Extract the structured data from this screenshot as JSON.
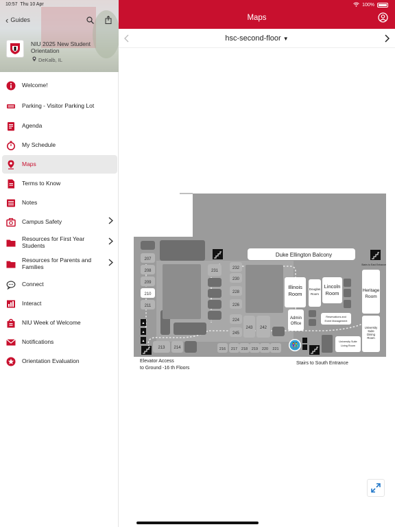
{
  "status": {
    "time": "10:57",
    "date": "Thu 10 Apr",
    "battery": "100%"
  },
  "sidebar": {
    "back_label": "Guides",
    "guide_title": "NIU 2025 New Student Orientation",
    "location": "DeKalb, IL",
    "items": [
      {
        "label": "Welcome!",
        "icon": "info-icon",
        "active": false
      },
      {
        "label": "Parking - Visitor Parking Lot",
        "icon": "parking-icon",
        "active": false
      },
      {
        "label": "Agenda",
        "icon": "agenda-icon",
        "active": false
      },
      {
        "label": "My Schedule",
        "icon": "schedule-icon",
        "active": false
      },
      {
        "label": "Maps",
        "icon": "map-pin-icon",
        "active": true
      },
      {
        "label": "Terms to Know",
        "icon": "document-icon",
        "active": false
      },
      {
        "label": "Notes",
        "icon": "notes-icon",
        "active": false
      },
      {
        "label": "Campus Safety",
        "icon": "first-aid-icon",
        "active": false,
        "has_children": true
      },
      {
        "label": "Resources for First Year Students",
        "icon": "folder-icon",
        "active": false,
        "has_children": true
      },
      {
        "label": "Resources for Parents and Families",
        "icon": "folder-icon",
        "active": false,
        "has_children": true
      },
      {
        "label": "Connect",
        "icon": "chat-icon",
        "active": false
      },
      {
        "label": "Interact",
        "icon": "interact-icon",
        "active": false
      },
      {
        "label": "NIU Week of Welcome",
        "icon": "badge-icon",
        "active": false
      },
      {
        "label": "Notifications",
        "icon": "envelope-icon",
        "active": false
      },
      {
        "label": "Orientation Evaluation",
        "icon": "star-icon",
        "active": false
      }
    ]
  },
  "header": {
    "title": "Maps"
  },
  "floor": {
    "selected": "hsc-second-floor"
  },
  "map": {
    "balcony": "Duke Ellington Balcony",
    "rooms": {
      "illinois": [
        "Illinois",
        "Room"
      ],
      "douglas": [
        "Douglas",
        "Room"
      ],
      "lincoln": [
        "Lincoln",
        "Room"
      ],
      "heritage": [
        "Heritage",
        "Room"
      ],
      "admin": [
        "Admin",
        "Office"
      ],
      "reservations": [
        "Reservations and",
        "Event Management"
      ],
      "suite_dining": [
        "University",
        "Suite",
        "Dining",
        "Room"
      ],
      "suite_living": [
        "University Suite",
        "Living Room"
      ]
    },
    "room_numbers": {
      "r207": "207",
      "r208": "208",
      "r209": "209",
      "r210": "210",
      "r211": "211",
      "r213": "213",
      "r214": "214",
      "r231": "231",
      "r232": "232",
      "r230": "230",
      "r228": "228",
      "r226": "226",
      "r224": "224",
      "r245": "245",
      "r243": "243",
      "r242": "242",
      "r216": "216",
      "r217": "217",
      "r218": "218",
      "r219": "219",
      "r220": "220",
      "r221": "221"
    },
    "stairs_east": "Stairs to East Entrance",
    "elevator_label": [
      "Elevator Access",
      "to Ground -16 th Floors"
    ],
    "stairs_south": "Stairs to South Entrance"
  },
  "colors": {
    "brand_red": "#c8102e",
    "map_gray": "#9b9b9b",
    "room_dark": "#6e6e6e"
  }
}
